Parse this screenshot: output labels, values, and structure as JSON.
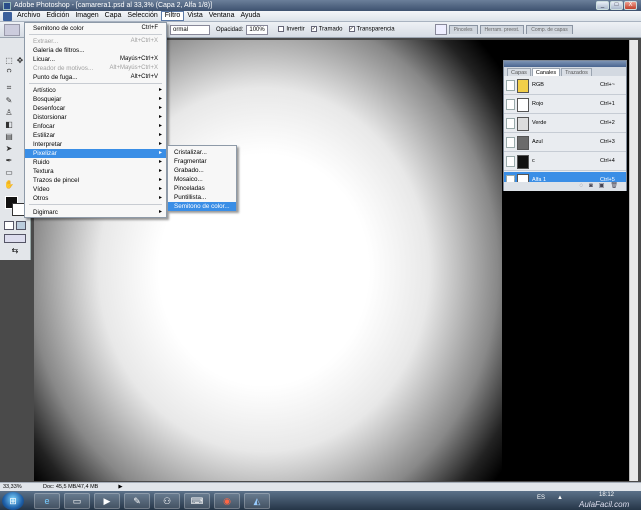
{
  "window": {
    "title": "Adobe Photoshop - [camarera1.psd al 33,3% (Capa 2, Alfa 1/8)]",
    "buttons": [
      "_",
      "□",
      "X"
    ]
  },
  "menubar": [
    "Archivo",
    "Edición",
    "Imagen",
    "Capa",
    "Selección",
    "Filtro",
    "Vista",
    "Ventana",
    "Ayuda"
  ],
  "optionsbar": {
    "mode_value": "ormal",
    "opacity_label": "Opacidad:",
    "opacity_value": "100%",
    "invertir": "Invertir",
    "tramado": "Tramado",
    "transparencia": "Transparencia",
    "palette_tabs": [
      "Pinceles",
      "Herram. preest.",
      "Comp. de capas"
    ]
  },
  "filter_menu": {
    "items": [
      {
        "label": "Semitono de color",
        "shortcut": "Ctrl+F"
      },
      {
        "label": "Extraer...",
        "shortcut": "Alt+Ctrl+X"
      },
      {
        "label": "Galería de filtros..."
      },
      {
        "label": "Licuar...",
        "shortcut": "Mayús+Ctrl+X"
      },
      {
        "label": "Creador de motivos...",
        "shortcut": "Alt+Mayús+Ctrl+X"
      },
      {
        "label": "Punto de fuga...",
        "shortcut": "Alt+Ctrl+V"
      },
      {
        "label": "Artístico"
      },
      {
        "label": "Bosquejar"
      },
      {
        "label": "Desenfocar"
      },
      {
        "label": "Distorsionar"
      },
      {
        "label": "Enfocar"
      },
      {
        "label": "Estilizar"
      },
      {
        "label": "Interpretar"
      },
      {
        "label": "Pixelizar"
      },
      {
        "label": "Ruido"
      },
      {
        "label": "Textura"
      },
      {
        "label": "Trazos de pincel"
      },
      {
        "label": "Vídeo"
      },
      {
        "label": "Otros"
      },
      {
        "label": "Digimarc"
      }
    ]
  },
  "pixelizar_submenu": [
    "Cristalizar...",
    "Fragmentar",
    "Grabado...",
    "Mosaico...",
    "Pinceladas",
    "Puntillista...",
    "Semitono de color..."
  ],
  "channels_panel": {
    "tabs": [
      "Capas",
      "Canales",
      "Trazados"
    ],
    "rows": [
      {
        "name": "RGB",
        "shortcut": "Ctrl+~",
        "thumb": "#f2cf4a"
      },
      {
        "name": "Rojo",
        "shortcut": "Ctrl+1",
        "thumb": "#ffffff"
      },
      {
        "name": "Verde",
        "shortcut": "Ctrl+2",
        "thumb": "#dcdcdc"
      },
      {
        "name": "Azul",
        "shortcut": "Ctrl+3",
        "thumb": "#6b6b6b"
      },
      {
        "name": "c",
        "shortcut": "Ctrl+4",
        "thumb": "#111111"
      },
      {
        "name": "Alfa 1",
        "shortcut": "Ctrl+5",
        "thumb": "#ffffff"
      }
    ]
  },
  "statusbar": {
    "zoom": "33,33%",
    "doc": "Doc: 45,5 MB/47,4 MB"
  },
  "taskbar": {
    "lang": "ES",
    "time": "18:12",
    "watermark": "AulaFacil.com"
  },
  "colors": {
    "highlight": "#3a8ee6",
    "titlebar": "#3e526f"
  }
}
